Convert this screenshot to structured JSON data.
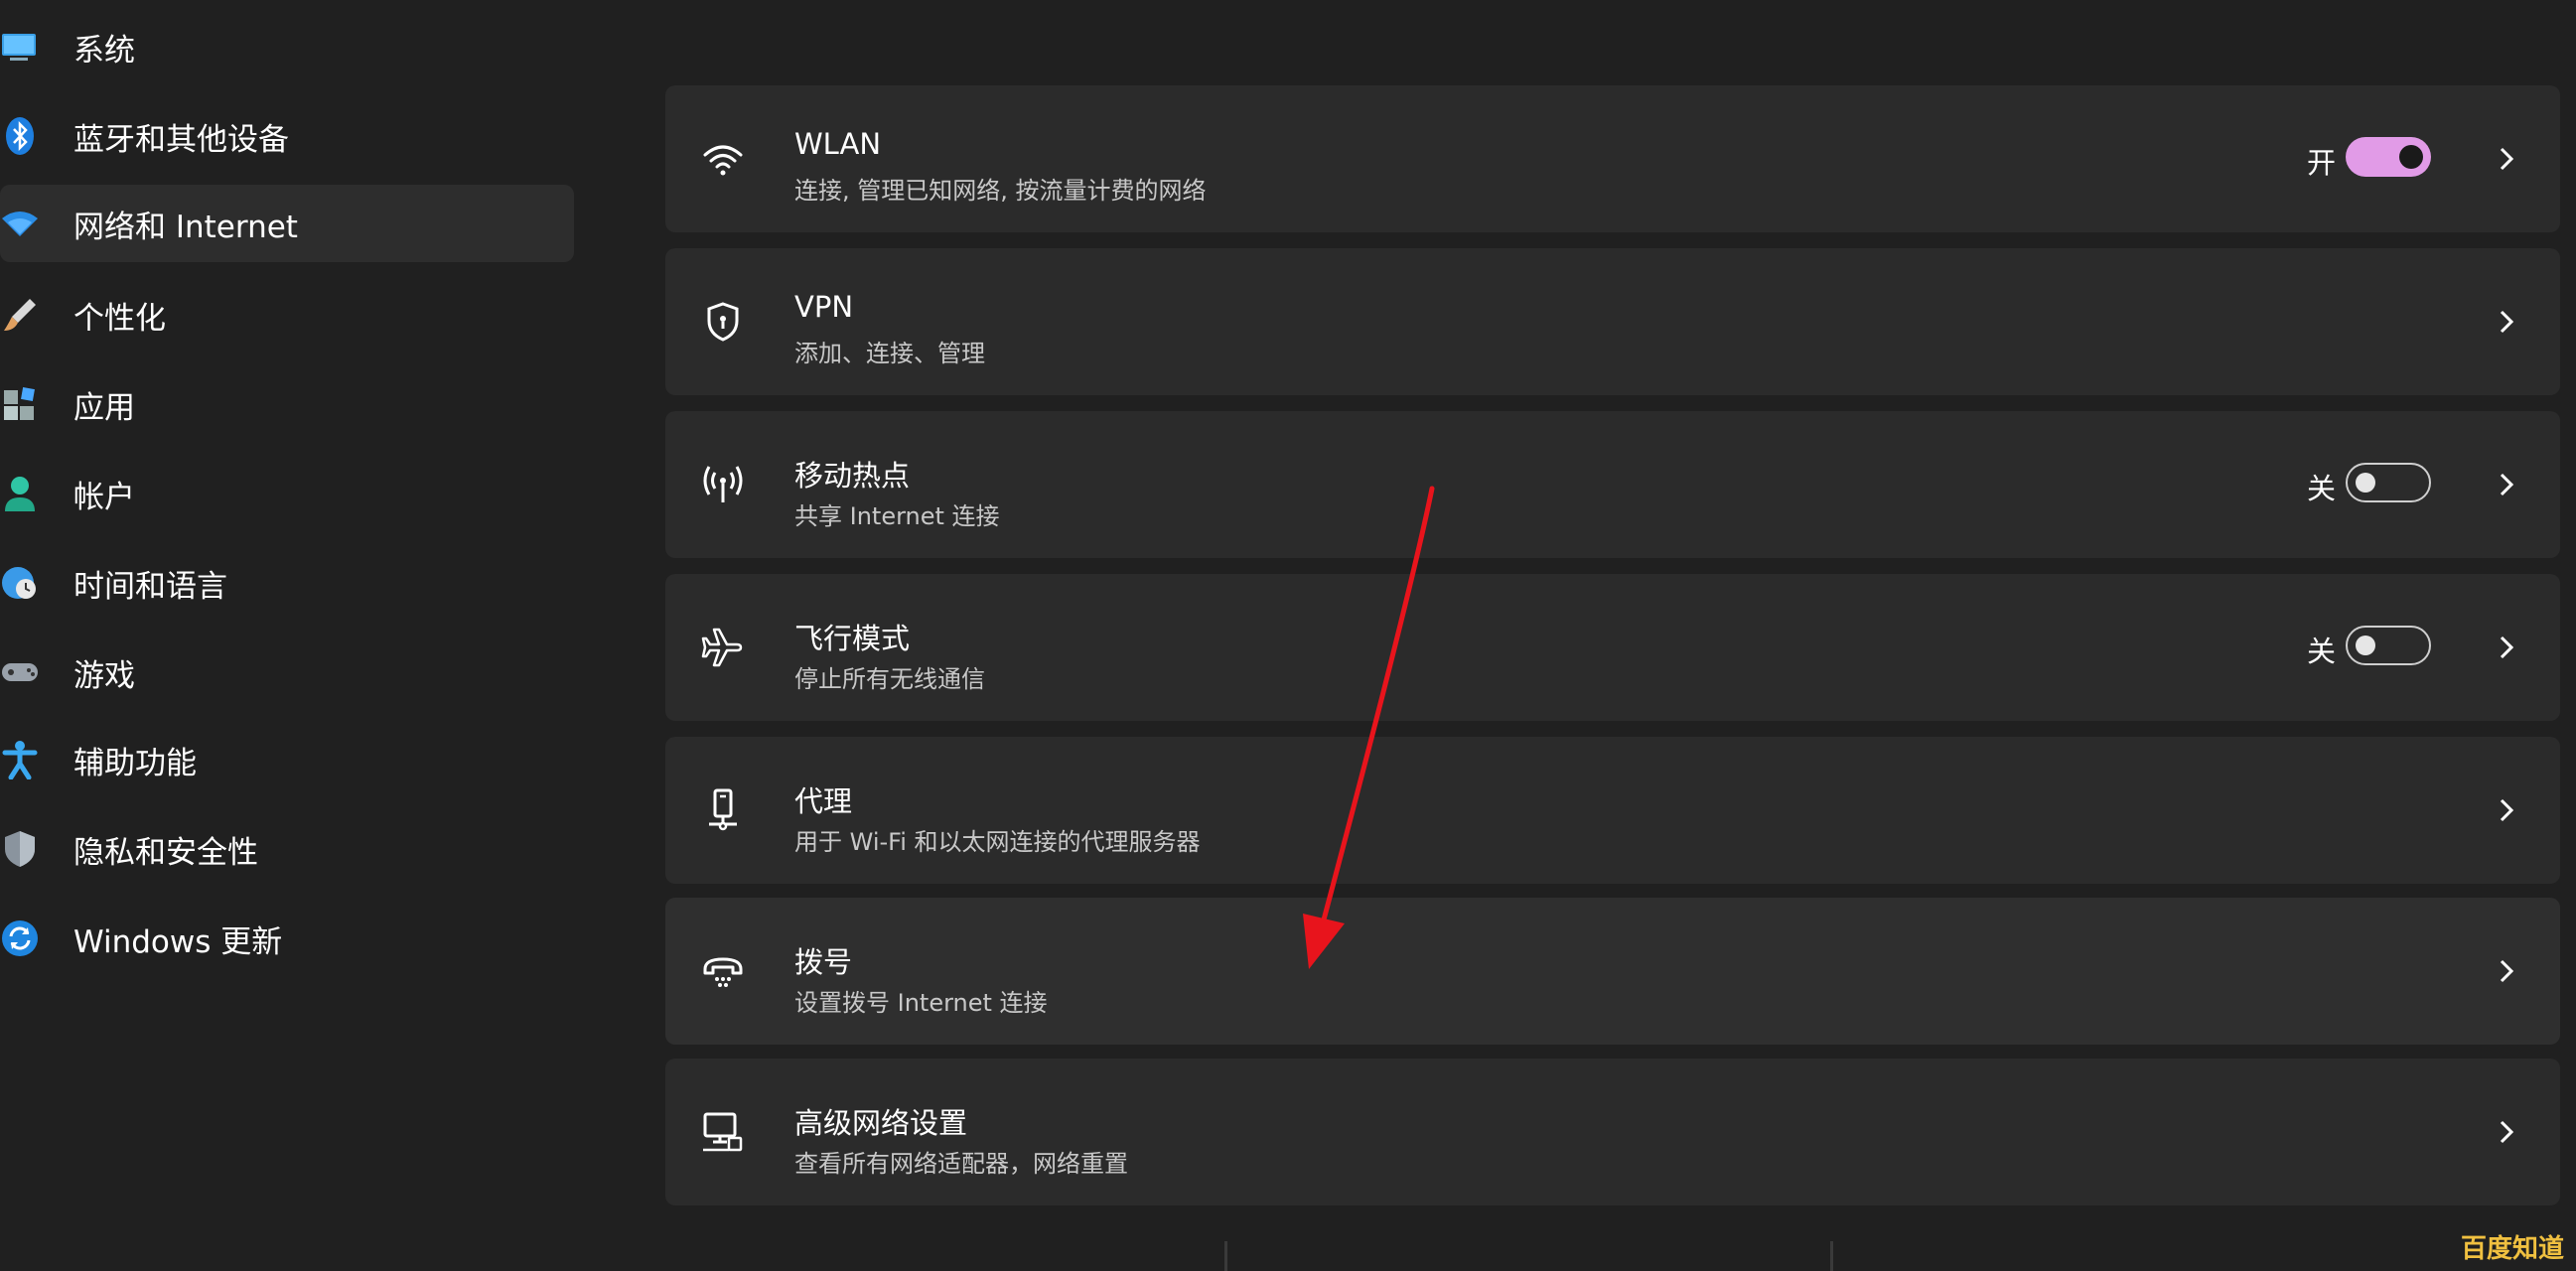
{
  "sidebar": {
    "items": [
      {
        "label": "系统",
        "icon": "monitor-icon"
      },
      {
        "label": "蓝牙和其他设备",
        "icon": "bluetooth-icon"
      },
      {
        "label": "网络和 Internet",
        "icon": "wifi-icon",
        "active": true
      },
      {
        "label": "个性化",
        "icon": "brush-icon"
      },
      {
        "label": "应用",
        "icon": "apps-icon"
      },
      {
        "label": "帐户",
        "icon": "account-icon"
      },
      {
        "label": "时间和语言",
        "icon": "globe-clock-icon"
      },
      {
        "label": "游戏",
        "icon": "gamepad-icon"
      },
      {
        "label": "辅助功能",
        "icon": "accessibility-icon"
      },
      {
        "label": "隐私和安全性",
        "icon": "shield-icon"
      },
      {
        "label": "Windows 更新",
        "icon": "update-icon"
      }
    ]
  },
  "settings": [
    {
      "title": "WLAN",
      "subtitle": "连接, 管理已知网络, 按流量计费的网络",
      "icon": "wifi-icon",
      "state": "开",
      "toggle": "on"
    },
    {
      "title": "VPN",
      "subtitle": "添加、连接、管理",
      "icon": "vpn-shield-icon"
    },
    {
      "title": "移动热点",
      "subtitle": "共享 Internet 连接",
      "icon": "hotspot-icon",
      "state": "关",
      "toggle": "off"
    },
    {
      "title": "飞行模式",
      "subtitle": "停止所有无线通信",
      "icon": "airplane-icon",
      "state": "关",
      "toggle": "off"
    },
    {
      "title": "代理",
      "subtitle": "用于 Wi-Fi 和以太网连接的代理服务器",
      "icon": "proxy-icon"
    },
    {
      "title": "拨号",
      "subtitle": "设置拨号 Internet 连接",
      "icon": "dialup-icon"
    },
    {
      "title": "高级网络设置",
      "subtitle": "查看所有网络适配器，网络重置",
      "icon": "network-adapter-icon"
    }
  ],
  "colors": {
    "background": "#202020",
    "card": "#2b2b2b",
    "toggle_on": "#e19be7",
    "annotation_arrow": "#e8141c"
  },
  "watermark": "百度知道"
}
